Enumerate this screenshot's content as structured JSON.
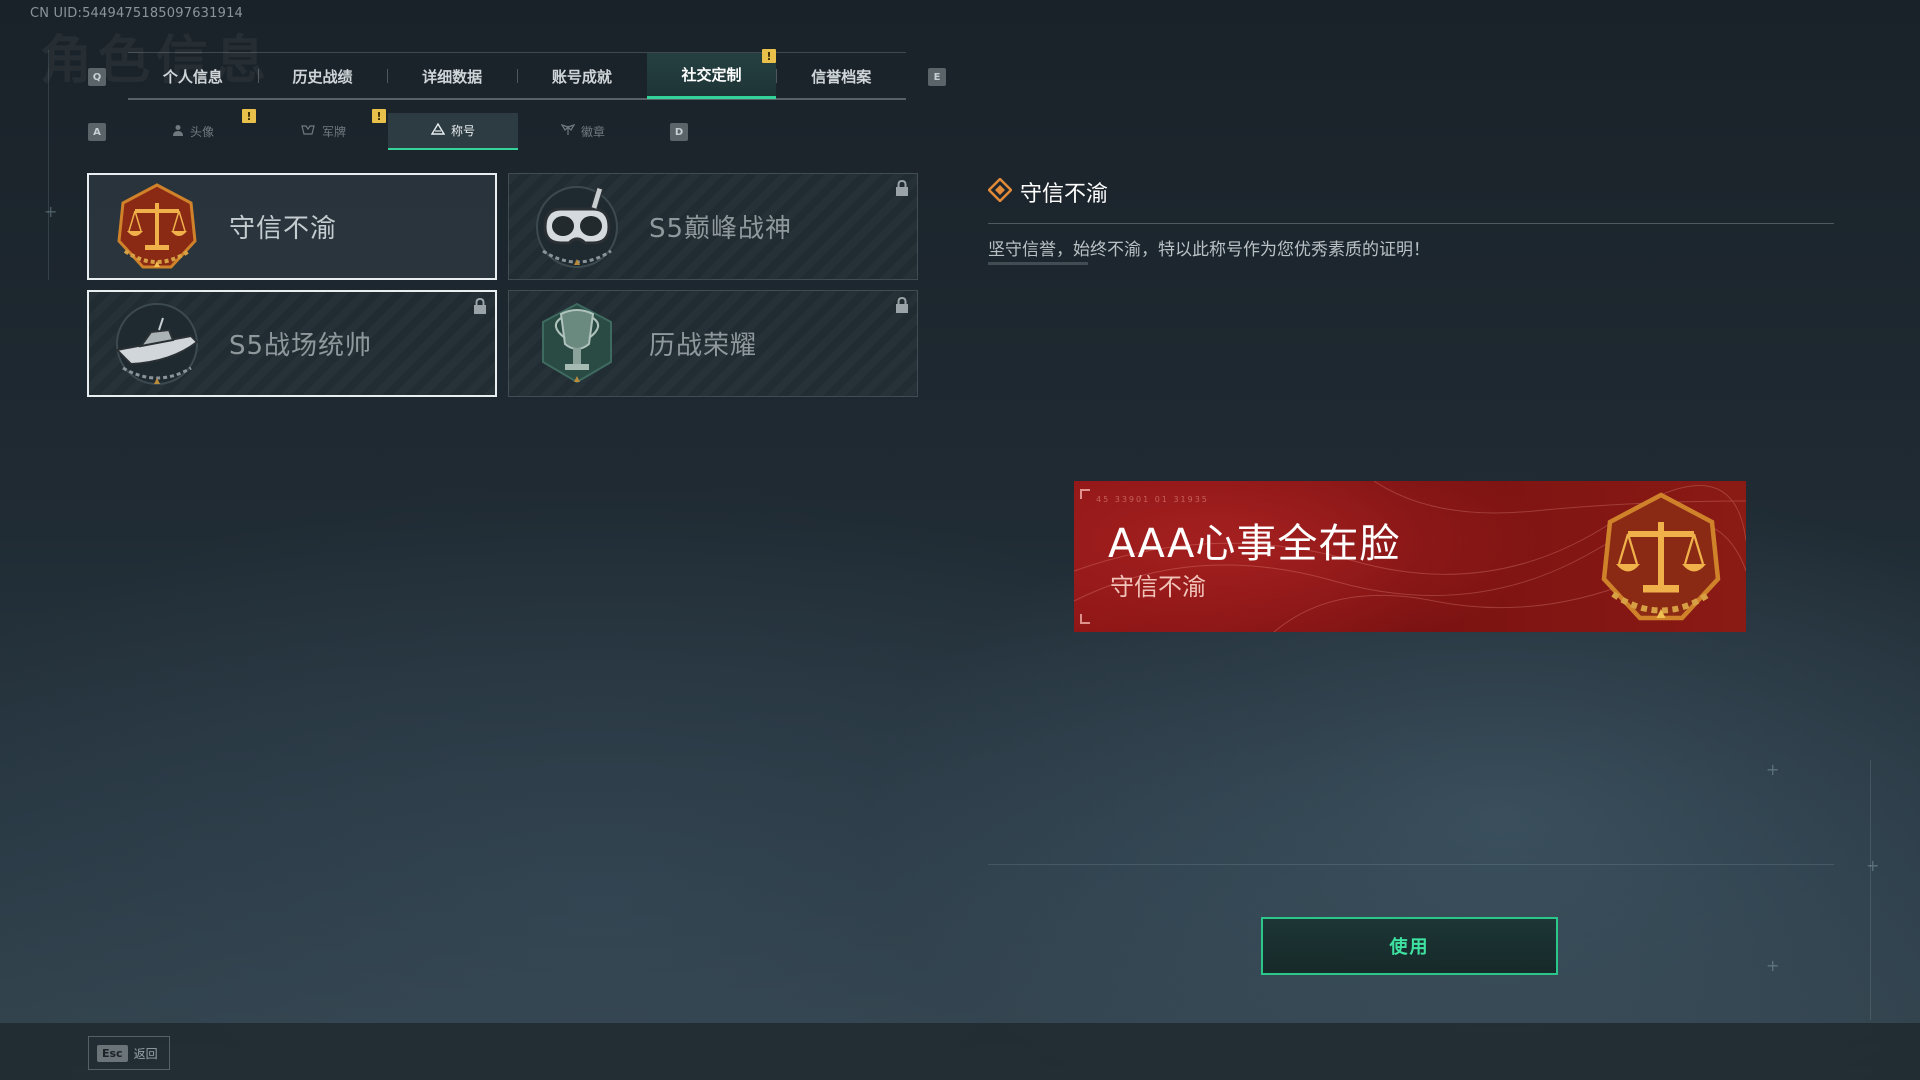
{
  "uid": "CN UID:5449475185097631914",
  "bg_heading": "角色信息",
  "tabs": {
    "prev_key": "Q",
    "next_key": "E",
    "items": [
      {
        "label": "个人信息"
      },
      {
        "label": "历史战绩"
      },
      {
        "label": "详细数据"
      },
      {
        "label": "账号成就"
      },
      {
        "label": "社交定制",
        "active": true,
        "badge": "!"
      },
      {
        "label": "信誉档案"
      }
    ]
  },
  "subtabs": {
    "prev_key": "A",
    "next_key": "D",
    "items": [
      {
        "label": "头像",
        "icon": "person-icon",
        "badge": "!"
      },
      {
        "label": "军牌",
        "icon": "dogtag-icon",
        "badge": "!"
      },
      {
        "label": "称号",
        "icon": "title-icon",
        "active": true
      },
      {
        "label": "徽章",
        "icon": "wings-icon"
      }
    ]
  },
  "titles": [
    {
      "name": "守信不渝",
      "emblem": "scales-emblem",
      "selected": true,
      "locked": false
    },
    {
      "name": "S5巅峰战神",
      "emblem": "diver-mask-emblem",
      "selected": false,
      "locked": true
    },
    {
      "name": "S5战场统帅",
      "emblem": "speedboat-emblem",
      "selected": false,
      "locked": true
    },
    {
      "name": "历战荣耀",
      "emblem": "trophy-emblem",
      "selected": false,
      "locked": true
    }
  ],
  "detail": {
    "title": "守信不渝",
    "description": "坚守信誉，始终不渝，特以此称号作为您优秀素质的证明！"
  },
  "preview": {
    "player_name": "AAA心事全在脸",
    "title": "守信不渝",
    "code": "45 33901   01 31935"
  },
  "use_button": "使用",
  "footer": {
    "key": "Esc",
    "label": "返回"
  },
  "colors": {
    "accent": "#34d39a",
    "badge": "#e8c04a",
    "banner": "#8e1515"
  }
}
